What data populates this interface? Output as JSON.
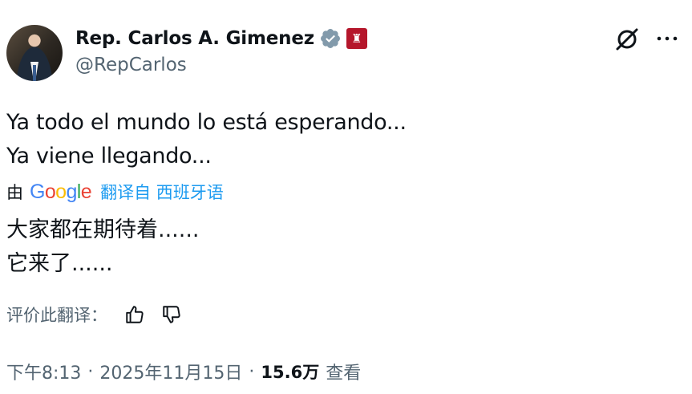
{
  "tweet": {
    "author": {
      "display_name": "Rep. Carlos A. Gimenez",
      "handle": "@RepCarlos",
      "verified_icon": "verified-badge-icon",
      "affiliation_icon": "capitol-icon"
    },
    "text_lines": [
      "Ya todo el mundo lo está esperando...",
      "Ya viene llegando..."
    ],
    "translation": {
      "by_word": "由",
      "provider": "Google",
      "link_text": "翻译自 西班牙语",
      "text_lines": [
        "大家都在期待着......",
        "它来了......"
      ]
    },
    "rate": {
      "label": "评价此翻译：",
      "up_icon": "thumbs-up-icon",
      "down_icon": "thumbs-down-icon"
    },
    "meta": {
      "time": "下午8:13",
      "date": "2025年11月15日",
      "views_count": "15.6万",
      "views_label": "查看"
    }
  },
  "header_actions": {
    "grok_icon": "grok-icon",
    "more_icon": "more-horizontal-icon"
  },
  "colors": {
    "text_primary": "#0f1419",
    "text_secondary": "#536471",
    "link": "#1d9bf0",
    "verified": "#829aab",
    "affiliation": "#b5162b"
  }
}
